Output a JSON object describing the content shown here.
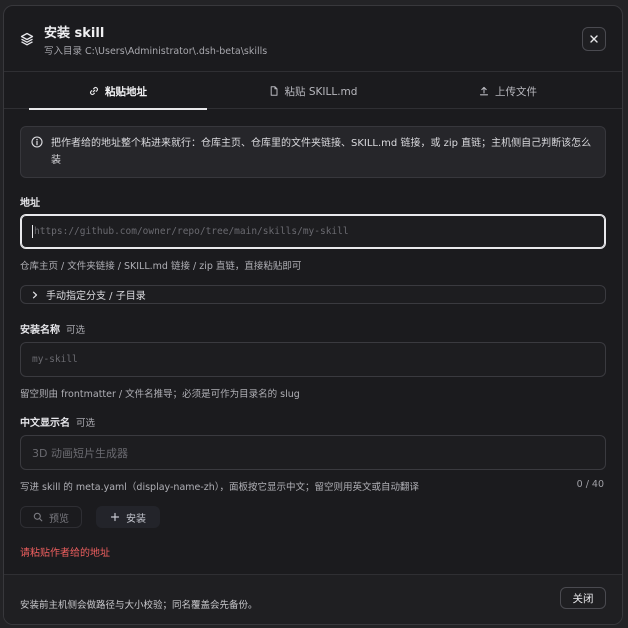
{
  "dialog": {
    "title": "安装 skill",
    "subtitle": "写入目录 C:\\Users\\Administrator\\.dsh-beta\\skills"
  },
  "tabs": [
    {
      "label": "粘贴地址",
      "icon": "link-icon",
      "active": true
    },
    {
      "label": "粘贴 SKILL.md",
      "icon": "file-icon",
      "active": false
    },
    {
      "label": "上传文件",
      "icon": "upload-icon",
      "active": false
    }
  ],
  "info": {
    "text": "把作者给的地址整个粘进来就行：仓库主页、仓库里的文件夹链接、SKILL.md 链接，或 zip 直链；主机侧自己判断该怎么装"
  },
  "address": {
    "label": "地址",
    "placeholder": "https://github.com/owner/repo/tree/main/skills/my-skill",
    "help": "仓库主页 / 文件夹链接 / SKILL.md 链接 / zip 直链，直接粘贴即可"
  },
  "manual": {
    "label": "手动指定分支 / 子目录"
  },
  "install_name": {
    "label": "安装名称",
    "optional": "可选",
    "placeholder": "my-skill",
    "help": "留空则由 frontmatter / 文件名推导；必须是可作为目录名的 slug"
  },
  "display_name": {
    "label": "中文显示名",
    "optional": "可选",
    "placeholder": "3D 动画短片生成器",
    "help": "写进 skill 的 meta.yaml（display-name-zh），面板按它显示中文；留空则用英文或自动翻译",
    "counter": "0 / 40"
  },
  "actions": {
    "preview": "预览",
    "install": "安装"
  },
  "error": "请粘贴作者给的地址",
  "footer": {
    "note": "安装前主机侧会做路径与大小校验；同名覆盖会先备份。",
    "close": "关闭"
  }
}
